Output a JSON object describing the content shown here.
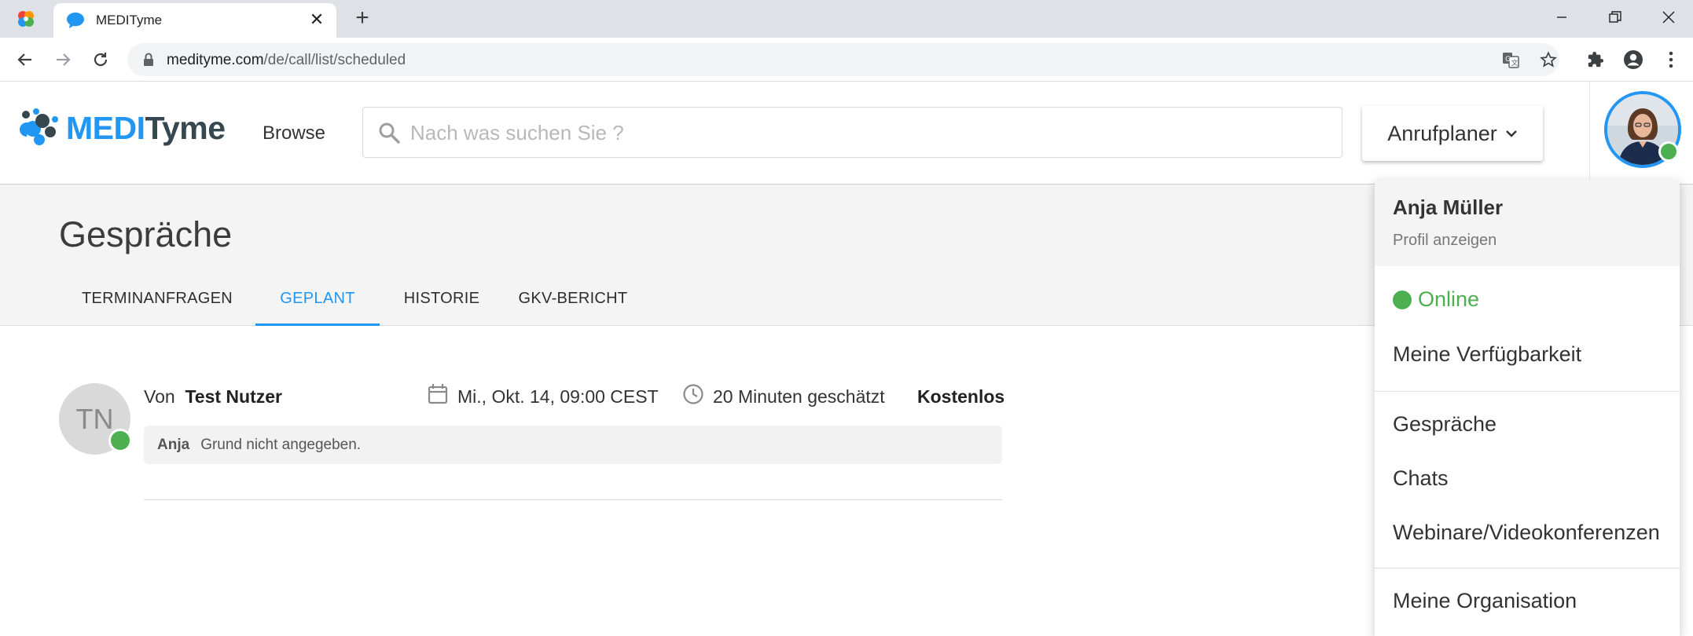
{
  "browser": {
    "tab_title": "MEDITyme",
    "url_host": "medityme.com",
    "url_path": "/de/call/list/scheduled"
  },
  "header": {
    "logo_medi": "MEDI",
    "logo_tyme": "Tyme",
    "browse_label": "Browse",
    "search_placeholder": "Nach was suchen Sie ?",
    "planner_label": "Anrufplaner"
  },
  "page": {
    "title": "Gespräche",
    "tabs": [
      {
        "label": "TERMINANFRAGEN",
        "active": false
      },
      {
        "label": "GEPLANT",
        "active": true
      },
      {
        "label": "HISTORIE",
        "active": false
      },
      {
        "label": "GKV-BERICHT",
        "active": false
      }
    ]
  },
  "call": {
    "initials": "TN",
    "from_prefix": "Von",
    "from_name": "Test Nutzer",
    "datetime": "Mi., Okt. 14, 09:00 CEST",
    "duration": "20 Minuten geschätzt",
    "price": "Kostenlos",
    "note_author": "Anja",
    "note_text": "Grund nicht angegeben."
  },
  "menu": {
    "user_name": "Anja Müller",
    "profile_link": "Profil anzeigen",
    "status": "Online",
    "items_group1": [
      "Meine Verfügbarkeit"
    ],
    "items_group2": [
      "Gespräche",
      "Chats",
      "Webinare/Videokonferenzen"
    ],
    "items_group3": [
      "Meine Organisation"
    ]
  },
  "colors": {
    "accent": "#2196f3",
    "online": "#4caf50",
    "logo_dark": "#37474f"
  }
}
